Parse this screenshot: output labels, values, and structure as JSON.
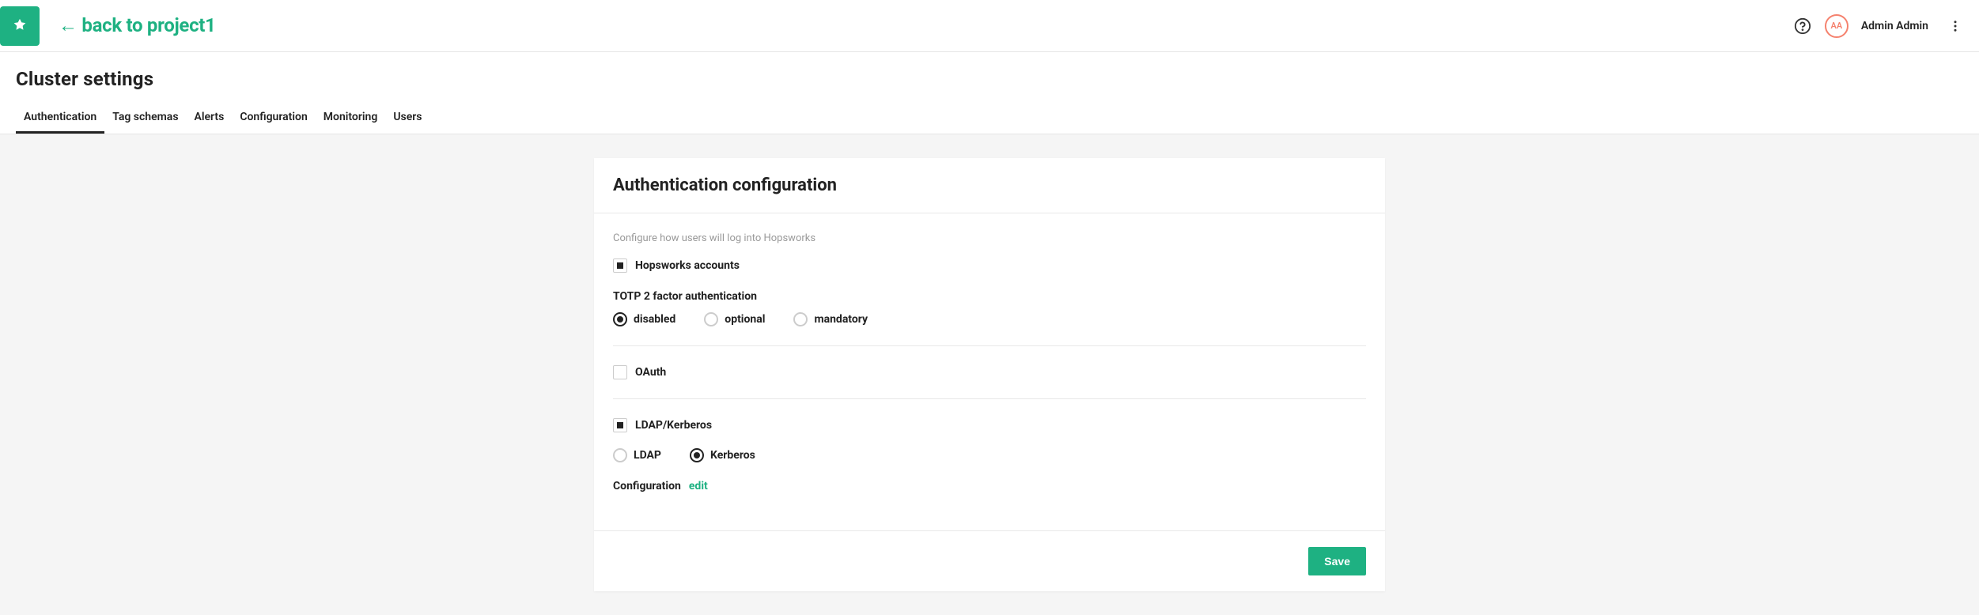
{
  "header": {
    "back_link": "← back to project1",
    "user_initials": "AA",
    "user_name": "Admin Admin"
  },
  "page": {
    "title": "Cluster settings",
    "tabs": [
      {
        "label": "Authentication",
        "active": true
      },
      {
        "label": "Tag schemas",
        "active": false
      },
      {
        "label": "Alerts",
        "active": false
      },
      {
        "label": "Configuration",
        "active": false
      },
      {
        "label": "Monitoring",
        "active": false
      },
      {
        "label": "Users",
        "active": false
      }
    ]
  },
  "card": {
    "title": "Authentication configuration",
    "helper": "Configure how users will log into Hopsworks",
    "sections": {
      "hopsworks": {
        "label": "Hopsworks accounts",
        "checked": true,
        "totp_label": "TOTP 2 factor authentication",
        "totp_options": [
          {
            "label": "disabled",
            "selected": true
          },
          {
            "label": "optional",
            "selected": false
          },
          {
            "label": "mandatory",
            "selected": false
          }
        ]
      },
      "oauth": {
        "label": "OAuth",
        "checked": false
      },
      "ldap": {
        "label": "LDAP/Kerberos",
        "checked": true,
        "options": [
          {
            "label": "LDAP",
            "selected": false
          },
          {
            "label": "Kerberos",
            "selected": true
          }
        ],
        "config_label": "Configuration",
        "edit_label": "edit"
      }
    },
    "save_label": "Save"
  }
}
